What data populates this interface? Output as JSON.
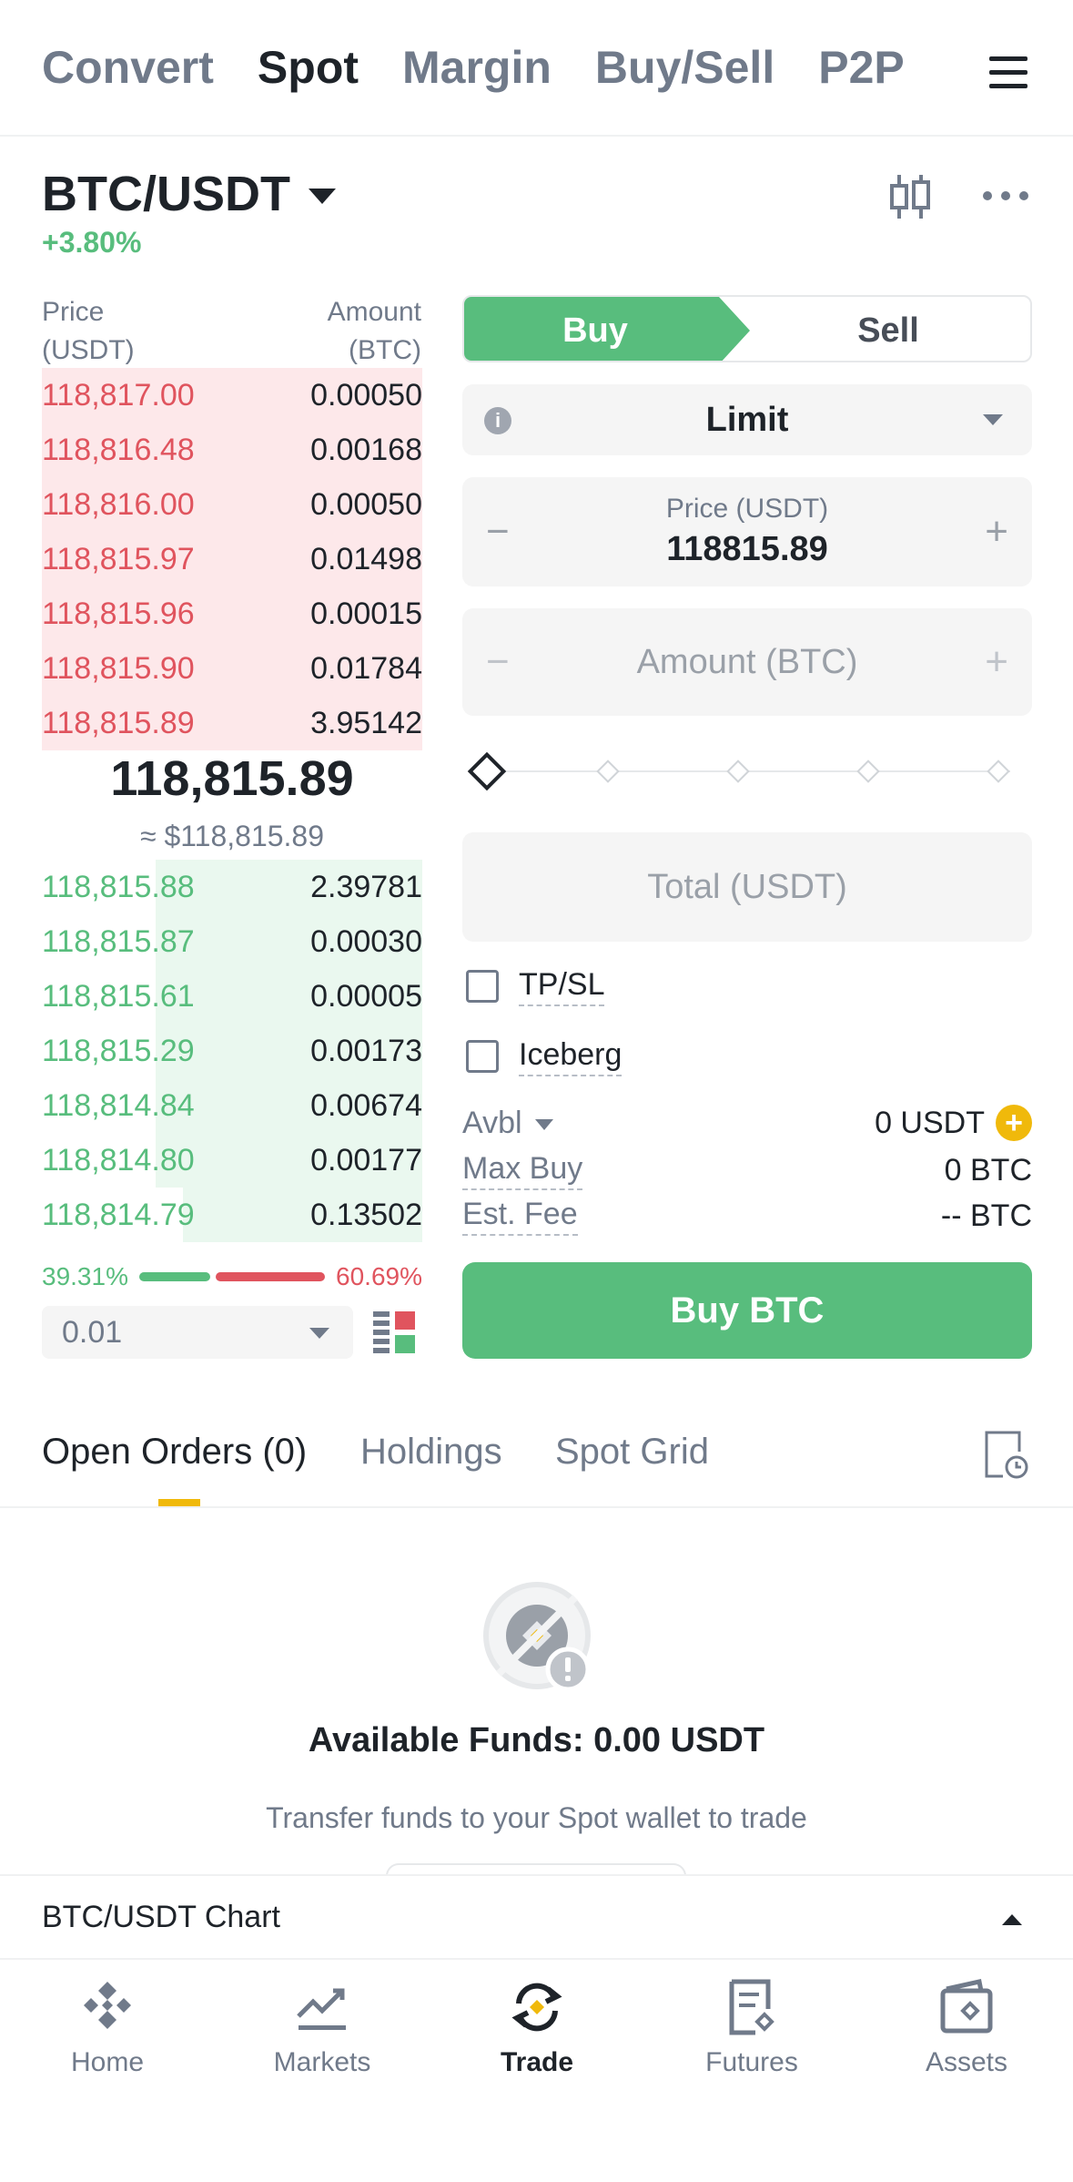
{
  "top_tabs": [
    "Convert",
    "Spot",
    "Margin",
    "Buy/Sell",
    "P2P"
  ],
  "pair": {
    "symbol": "BTC/USDT",
    "change": "+3.80%"
  },
  "orderbook": {
    "price_header_1": "Price",
    "price_header_2": "(USDT)",
    "amount_header_1": "Amount",
    "amount_header_2": "(BTC)",
    "asks": [
      {
        "price": "118,817.00",
        "amount": "0.00050",
        "depth": 1.0
      },
      {
        "price": "118,816.48",
        "amount": "0.00168",
        "depth": 1.0
      },
      {
        "price": "118,816.00",
        "amount": "0.00050",
        "depth": 1.0
      },
      {
        "price": "118,815.97",
        "amount": "0.01498",
        "depth": 1.0
      },
      {
        "price": "118,815.96",
        "amount": "0.00015",
        "depth": 1.0
      },
      {
        "price": "118,815.90",
        "amount": "0.01784",
        "depth": 1.0
      },
      {
        "price": "118,815.89",
        "amount": "3.95142",
        "depth": 1.0
      }
    ],
    "mid_price": "118,815.89",
    "mid_usd": "≈ $118,815.89",
    "bids": [
      {
        "price": "118,815.88",
        "amount": "2.39781",
        "depth": 0.7
      },
      {
        "price": "118,815.87",
        "amount": "0.00030",
        "depth": 0.7
      },
      {
        "price": "118,815.61",
        "amount": "0.00005",
        "depth": 0.7
      },
      {
        "price": "118,815.29",
        "amount": "0.00173",
        "depth": 0.7
      },
      {
        "price": "118,814.84",
        "amount": "0.00674",
        "depth": 0.7
      },
      {
        "price": "118,814.80",
        "amount": "0.00177",
        "depth": 0.7
      },
      {
        "price": "118,814.79",
        "amount": "0.13502",
        "depth": 0.63
      }
    ],
    "buy_ratio": "39.31%",
    "sell_ratio": "60.69%",
    "buy_ratio_value": 39.31,
    "precision": "0.01"
  },
  "trade_form": {
    "buy_label": "Buy",
    "sell_label": "Sell",
    "order_type": "Limit",
    "info_glyph": "i",
    "price_label": "Price (USDT)",
    "price_value": "118815.89",
    "minus_glyph": "−",
    "plus_glyph": "+",
    "amount_placeholder": "Amount (BTC)",
    "total_placeholder": "Total (USDT)",
    "tpsl_label": "TP/SL",
    "iceberg_label": "Iceberg",
    "avbl_label": "Avbl",
    "avbl_value": "0 USDT",
    "maxbuy_label": "Max Buy",
    "maxbuy_value": "0 BTC",
    "fee_label": "Est. Fee",
    "fee_value": "-- BTC",
    "submit_label": "Buy BTC"
  },
  "orders": {
    "tabs": [
      "Open Orders (0)",
      "Holdings",
      "Spot Grid"
    ],
    "empty_title": "Available Funds: 0.00 USDT",
    "empty_sub": "Transfer funds to your Spot wallet to trade"
  },
  "chart_bar": {
    "label": "BTC/USDT Chart"
  },
  "bottom_nav": [
    "Home",
    "Markets",
    "Trade",
    "Futures",
    "Assets"
  ],
  "colors": {
    "buy": "#58bd7d",
    "sell": "#e0545e",
    "accent": "#f0b90b",
    "text": "#1e2329",
    "muted": "#707a8a"
  },
  "icons": [
    "menu-icon",
    "caret-down-icon",
    "candlestick-icon",
    "more-icon",
    "info-icon",
    "layout-icon",
    "history-icon",
    "no-funds-icon",
    "home-icon",
    "markets-icon",
    "trade-icon",
    "futures-icon",
    "assets-icon"
  ]
}
